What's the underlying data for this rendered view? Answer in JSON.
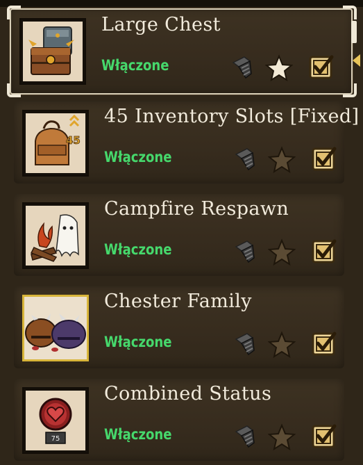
{
  "mods": [
    {
      "title": "Large Chest",
      "status": "Włączone",
      "selected": true,
      "favorited": true,
      "enabled": true,
      "status_color": "#46d86c"
    },
    {
      "title": "45 Inventory Slots [Fixed]",
      "status": "Włączone",
      "selected": false,
      "favorited": false,
      "enabled": true,
      "badge": "45"
    },
    {
      "title": "Campfire Respawn",
      "status": "Włączone",
      "selected": false,
      "favorited": false,
      "enabled": true
    },
    {
      "title": "Chester Family",
      "status": "Włączone",
      "selected": false,
      "favorited": false,
      "enabled": true
    },
    {
      "title": "Combined Status",
      "status": "Włączone",
      "selected": false,
      "favorited": false,
      "enabled": true,
      "badge": "75"
    }
  ],
  "icons": {
    "configure": "bolt-icon",
    "favorite": "star-icon",
    "enable": "checkbox-icon"
  },
  "colors": {
    "enabled_text": "#46d86c",
    "title_text": "#f2ebdc",
    "selection_frame": "#efe8d6",
    "selected_arrow": "#e8c45a"
  }
}
